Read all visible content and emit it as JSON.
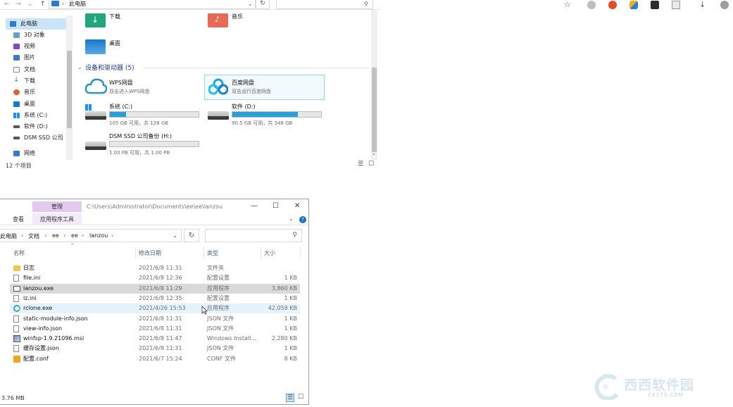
{
  "top_window": {
    "breadcrumb": "此电脑",
    "nav_items": [
      {
        "label": "此电脑",
        "color": "#2b7bd4"
      },
      {
        "label": "3D 对象",
        "color": "#6aa0c8"
      },
      {
        "label": "视频",
        "color": "#7b4fb3"
      },
      {
        "label": "图片",
        "color": "#3a7bc8"
      },
      {
        "label": "文档",
        "color": "#8a8a8a"
      },
      {
        "label": "下载",
        "color": "#2a8fd1"
      },
      {
        "label": "音乐",
        "color": "#e0622a"
      },
      {
        "label": "桌面",
        "color": "#1a76c9"
      },
      {
        "label": "系统 (C:)",
        "color": "#7a7a7a"
      },
      {
        "label": "软件 (D:)",
        "color": "#555555"
      },
      {
        "label": "DSM SSD 公司",
        "color": "#555555"
      },
      {
        "label": "网络",
        "color": "#3a7bc8"
      }
    ],
    "folders": [
      {
        "label": "下载",
        "color": "#20a67a"
      },
      {
        "label": "音乐",
        "color": "#e86a55"
      },
      {
        "label": "桌面",
        "color": "#1a76c9"
      }
    ],
    "group_header": "设备和驱动器 (5)",
    "apps": [
      {
        "label": "WPS网盘",
        "sub": "双击进入WPS网盘"
      },
      {
        "label": "百度网盘",
        "sub": "双击运行百度网盘"
      }
    ],
    "drives": [
      {
        "label": "系统 (C:)",
        "sub": "105 GB 可用，共 128 GB",
        "used_fraction": 0.18
      },
      {
        "label": "软件 (D:)",
        "sub": "90.5 GB 可用，共 348 GB",
        "used_fraction": 0.74
      },
      {
        "label": "DSM SSD 公司备份 (H:)",
        "sub": "1.00 PB 可用，共 1.00 PB",
        "used_fraction": 0.0
      }
    ],
    "status": "12 个项目"
  },
  "browser_toolbar": {
    "icons": [
      "star-settings-icon",
      "extension-gray-icon",
      "red-extension-icon",
      "shield-extension-icon",
      "dark-extension-icon",
      "window-icon",
      "download-icon",
      "profile-icon"
    ]
  },
  "bottom_window": {
    "manage_label": "管理",
    "path": "C:\\Users\\Administrator\\Documents\\ee\\ee\\lanzou",
    "tab_view": "查看",
    "tab_app_tools": "应用程序工具",
    "breadcrumbs": [
      "此电脑",
      "文档",
      "ee",
      "ee",
      "lanzou"
    ],
    "columns": {
      "name": "名称",
      "date": "修改日期",
      "type": "类型",
      "size": "大小"
    },
    "files": [
      {
        "name": "日志",
        "date": "2021/6/8 11:31",
        "type": "文件夹",
        "size": "",
        "icon": "folder-icon",
        "state": ""
      },
      {
        "name": "file.ini",
        "date": "2021/6/8 12:36",
        "type": "配置设置",
        "size": "1 KB",
        "icon": "ini-file-icon",
        "state": ""
      },
      {
        "name": "lanzou.exe",
        "date": "2021/6/8 11:29",
        "type": "应用程序",
        "size": "3,860 KB",
        "icon": "exe-file-icon",
        "state": "selected"
      },
      {
        "name": "lz.ini",
        "date": "2021/6/8 12:35",
        "type": "配置设置",
        "size": "1 KB",
        "icon": "ini-file-icon",
        "state": ""
      },
      {
        "name": "rclone.exe",
        "date": "2021/4/26 15:53",
        "type": "应用程序",
        "size": "42,059 KB",
        "icon": "rclone-icon",
        "state": "hover"
      },
      {
        "name": "static-module-info.json",
        "date": "2021/6/8 11:31",
        "type": "JSON 文件",
        "size": "1 KB",
        "icon": "json-file-icon",
        "state": ""
      },
      {
        "name": "view-info.json",
        "date": "2021/6/8 11:31",
        "type": "JSON 文件",
        "size": "1 KB",
        "icon": "json-file-icon",
        "state": ""
      },
      {
        "name": "winfsp-1.9.21096.msi",
        "date": "2021/6/8 11:47",
        "type": "Windows Install...",
        "size": "2,280 KB",
        "icon": "msi-file-icon",
        "state": ""
      },
      {
        "name": "缓存设置.json",
        "date": "2021/6/8 11:31",
        "type": "JSON 文件",
        "size": "1 KB",
        "icon": "json-file-icon",
        "state": ""
      },
      {
        "name": "配置.conf",
        "date": "2021/6/7 15:24",
        "type": "CONF 文件",
        "size": "8 KB",
        "icon": "conf-file-icon",
        "state": ""
      }
    ],
    "status": "3.76 MB"
  },
  "watermark": {
    "main": "西西软件园",
    "sub": "CR173.COM"
  }
}
